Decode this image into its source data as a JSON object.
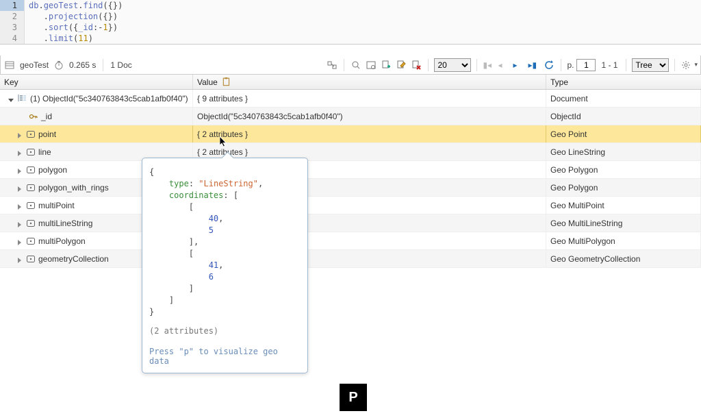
{
  "editor": {
    "lines": [
      {
        "num": "1",
        "parts": [
          {
            "t": "db",
            "c": "hl-ident"
          },
          {
            "t": ".",
            "c": "hl-punc"
          },
          {
            "t": "geoTest",
            "c": "hl-ident"
          },
          {
            "t": ".",
            "c": "hl-punc"
          },
          {
            "t": "find",
            "c": "hl-ident"
          },
          {
            "t": "({})",
            "c": "hl-punc"
          }
        ]
      },
      {
        "num": "2",
        "parts": [
          {
            "t": "   .",
            "c": "hl-punc"
          },
          {
            "t": "projection",
            "c": "hl-ident"
          },
          {
            "t": "({})",
            "c": "hl-punc"
          }
        ]
      },
      {
        "num": "3",
        "parts": [
          {
            "t": "   .",
            "c": "hl-punc"
          },
          {
            "t": "sort",
            "c": "hl-ident"
          },
          {
            "t": "({",
            "c": "hl-punc"
          },
          {
            "t": "_id",
            "c": "hl-ident"
          },
          {
            "t": ":-",
            "c": "hl-punc"
          },
          {
            "t": "1",
            "c": "hl-num2"
          },
          {
            "t": "})",
            "c": "hl-punc"
          }
        ]
      },
      {
        "num": "4",
        "parts": [
          {
            "t": "   .",
            "c": "hl-punc"
          },
          {
            "t": "limit",
            "c": "hl-ident"
          },
          {
            "t": "(",
            "c": "hl-punc"
          },
          {
            "t": "11",
            "c": "hl-num2"
          },
          {
            "t": ")",
            "c": "hl-punc"
          }
        ]
      }
    ]
  },
  "toolbar": {
    "collection": "geoTest",
    "time": "0.265 s",
    "docCount": "1 Doc",
    "pageSize": "20",
    "pageLabel": "p.",
    "pageNum": "1",
    "pageRange": "1 - 1",
    "viewMode": "Tree"
  },
  "headers": {
    "key": "Key",
    "value": "Value",
    "type": "Type"
  },
  "rows": [
    {
      "indent": 12,
      "exp": "down",
      "iconKind": "doc",
      "key": "(1) ObjectId(\"5c340763843c5cab1afb0f40\")",
      "val": "{ 9 attributes }",
      "type": "Document",
      "cls": "odd"
    },
    {
      "indent": 28,
      "exp": "",
      "iconKind": "key",
      "key": "_id",
      "val": "ObjectId(\"5c340763843c5cab1afb0f40\")",
      "type": "ObjectId",
      "cls": "even"
    },
    {
      "indent": 24,
      "exp": "right",
      "iconKind": "geo",
      "key": "point",
      "val": "{ 2 attributes }",
      "type": "Geo Point",
      "cls": "sel"
    },
    {
      "indent": 24,
      "exp": "right",
      "iconKind": "geo",
      "key": "line",
      "val": "{ 2 attributes }",
      "type": "Geo LineString",
      "cls": "even"
    },
    {
      "indent": 24,
      "exp": "right",
      "iconKind": "geo",
      "key": "polygon",
      "val": "",
      "type": "Geo Polygon",
      "cls": "odd"
    },
    {
      "indent": 24,
      "exp": "right",
      "iconKind": "geo",
      "key": "polygon_with_rings",
      "val": "",
      "type": "Geo Polygon",
      "cls": "even"
    },
    {
      "indent": 24,
      "exp": "right",
      "iconKind": "geo",
      "key": "multiPoint",
      "val": "",
      "type": "Geo MultiPoint",
      "cls": "odd"
    },
    {
      "indent": 24,
      "exp": "right",
      "iconKind": "geo",
      "key": "multiLineString",
      "val": "",
      "type": "Geo MultiLineString",
      "cls": "even"
    },
    {
      "indent": 24,
      "exp": "right",
      "iconKind": "geo",
      "key": "multiPolygon",
      "val": "",
      "type": "Geo MultiPolygon",
      "cls": "odd"
    },
    {
      "indent": 24,
      "exp": "right",
      "iconKind": "geo",
      "key": "geometryCollection",
      "val": "",
      "type": "Geo GeometryCollection",
      "cls": "even"
    }
  ],
  "tooltip": {
    "lines": [
      [
        {
          "t": "{"
        }
      ],
      [
        {
          "t": "    "
        },
        {
          "t": "type",
          "c": "tt-key"
        },
        {
          "t": ": "
        },
        {
          "t": "\"LineString\"",
          "c": "tt-str"
        },
        {
          "t": ","
        }
      ],
      [
        {
          "t": "    "
        },
        {
          "t": "coordinates",
          "c": "tt-key"
        },
        {
          "t": ": ["
        }
      ],
      [
        {
          "t": "        ["
        }
      ],
      [
        {
          "t": "            "
        },
        {
          "t": "40",
          "c": "tt-num"
        },
        {
          "t": ","
        }
      ],
      [
        {
          "t": "            "
        },
        {
          "t": "5",
          "c": "tt-num"
        }
      ],
      [
        {
          "t": "        ],"
        }
      ],
      [
        {
          "t": "        ["
        }
      ],
      [
        {
          "t": "            "
        },
        {
          "t": "41",
          "c": "tt-num"
        },
        {
          "t": ","
        }
      ],
      [
        {
          "t": "            "
        },
        {
          "t": "6",
          "c": "tt-num"
        }
      ],
      [
        {
          "t": "        ]"
        }
      ],
      [
        {
          "t": "    ]"
        }
      ],
      [
        {
          "t": "}"
        }
      ]
    ],
    "meta": "(2 attributes)",
    "hint": "Press \"p\" to visualize geo data"
  },
  "pIcon": "P"
}
